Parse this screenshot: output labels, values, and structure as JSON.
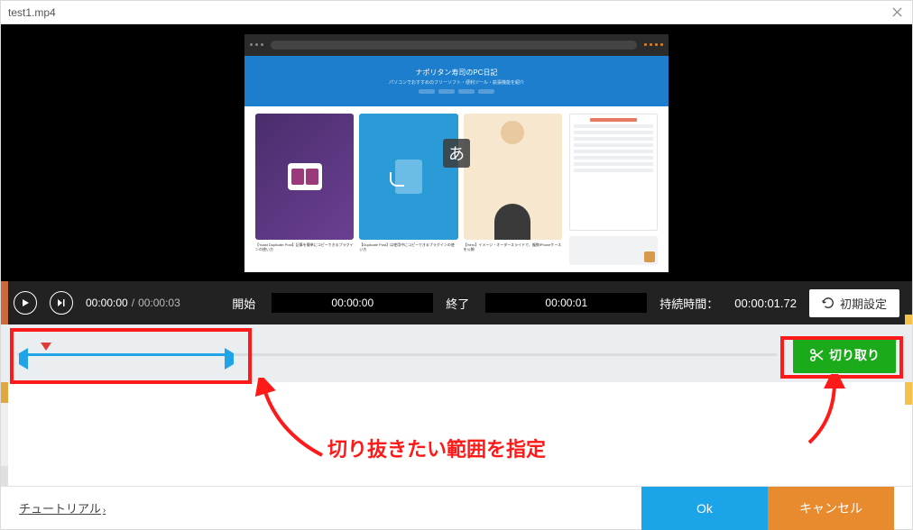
{
  "window": {
    "title": "test1.mp4"
  },
  "ime": {
    "char": "あ"
  },
  "preview_banner": {
    "title": "ナポリタン寿司のPC日記"
  },
  "controls": {
    "current_time": "00:00:00",
    "total_time": "00:00:03",
    "start_label": "開始",
    "start_value": "00:00:00",
    "end_label": "終了",
    "end_value": "00:00:01",
    "duration_label": "持続時間：",
    "duration_value": "00:00:01.72",
    "reset_label": "初期設定"
  },
  "timeline": {
    "cut_label": "切り取り"
  },
  "annotation_text": "切り抜きたい範囲を指定",
  "footer": {
    "tutorial": "チュートリアル",
    "ok": "Ok",
    "cancel": "キャンセル"
  }
}
